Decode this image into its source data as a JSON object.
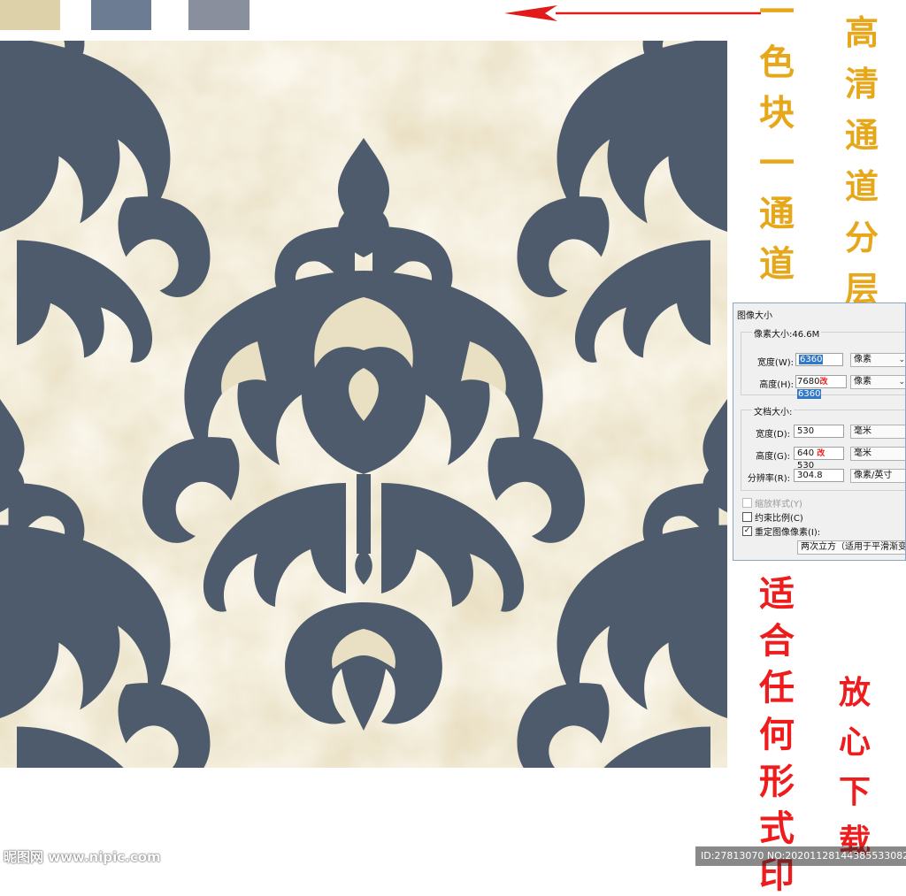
{
  "swatches": [
    {
      "name": "beige",
      "color": "#dcd1a8"
    },
    {
      "name": "slate-blue",
      "color": "#6c7c93"
    },
    {
      "name": "grey-blue",
      "color": "#8a8f9d"
    }
  ],
  "colors": {
    "pattern_bg": "#e9dfc2",
    "pattern_motif": "#4d5b6c",
    "gold_text": "#e7a71b",
    "red_text": "#ee1c1c",
    "arrow": "#e21a1a"
  },
  "annotations": {
    "gold_col_1": [
      "一",
      "色",
      "块",
      "一",
      "通",
      "道"
    ],
    "gold_col_2": [
      "高",
      "清",
      "通",
      "道",
      "分",
      "层"
    ],
    "red_col_1": [
      "适",
      "合",
      "任",
      "何",
      "形",
      "式",
      "印"
    ],
    "red_col_2": [
      "放",
      "心",
      "下",
      "载"
    ]
  },
  "dialog": {
    "title": "图像大小",
    "pixel_dimensions": "像素大小:46.6M",
    "width_label": "宽度(W):",
    "width_value": "6360",
    "width_unit": "像素",
    "height_label": "高度(H):",
    "height_old": "7680",
    "height_mark": "改",
    "height_value": "6360",
    "height_unit": "像素",
    "doc_size": "文档大小:",
    "doc_width_label": "宽度(D):",
    "doc_width_value": "530",
    "doc_width_unit": "毫米",
    "doc_height_label": "高度(G):",
    "doc_height_old": "640",
    "doc_height_mark": "改",
    "doc_height_value": "530",
    "doc_height_unit": "毫米",
    "resolution_label": "分辨率(R):",
    "resolution_value": "304.8",
    "resolution_unit": "像素/英寸",
    "scale_styles": "缩放样式(Y)",
    "constrain": "约束比例(C)",
    "resample": "重定图像像素(I):",
    "resample_method": "两次立方（适用于平滑渐变）"
  },
  "watermark": "昵图网 www.nipic.com",
  "id_text": "ID:27813070 NO:20201128144385533082"
}
